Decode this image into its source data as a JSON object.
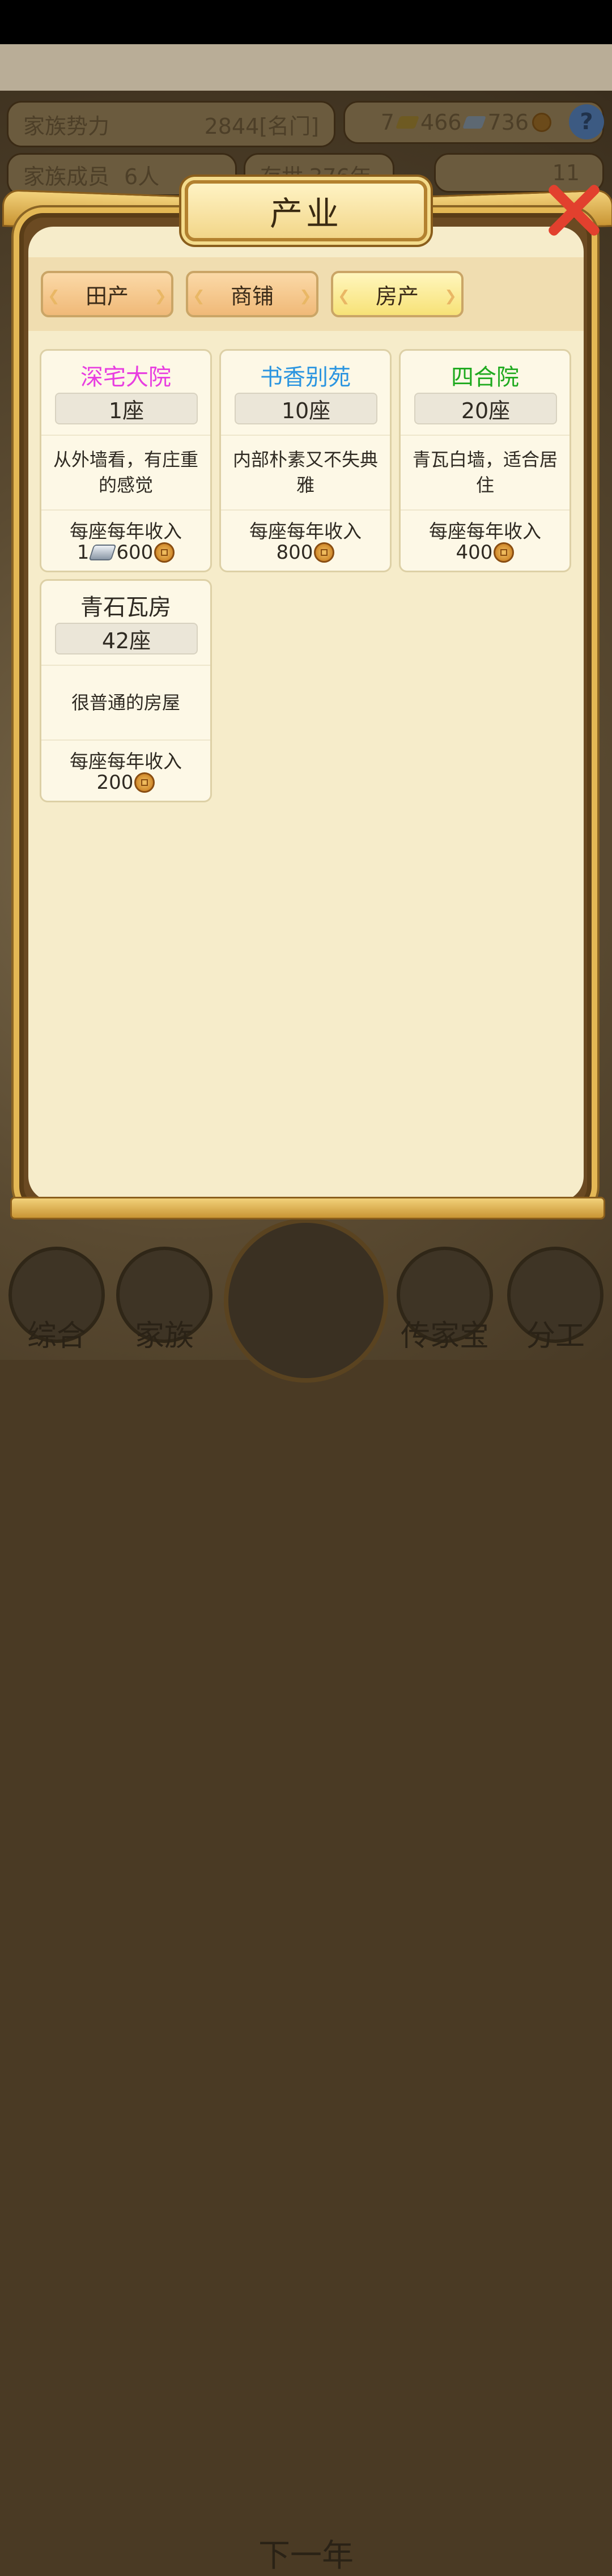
{
  "background_hud": {
    "family_power_label": "家族势力",
    "family_power_value": "2844",
    "family_power_rank": "[名门]",
    "gold_count": "7",
    "silver_count": "466",
    "coin_count": "736",
    "help_label": "?",
    "members_label": "家族成员",
    "members_value": "6人",
    "existence_label": "存世",
    "existence_value": "376年",
    "yuanbao_count": "11"
  },
  "dialog": {
    "title": "产业",
    "tabs": [
      {
        "label": "田产",
        "active": false
      },
      {
        "label": "商铺",
        "active": false
      },
      {
        "label": "房产",
        "active": true
      }
    ],
    "cards": [
      {
        "name": "深宅大院",
        "name_color": "#e83ee0",
        "count": "1座",
        "description": "从外墙看，有庄重的感觉",
        "income_label": "每座每年收入",
        "income_silver": "1",
        "income_coins": "600"
      },
      {
        "name": "书香别苑",
        "name_color": "#2b95e0",
        "count": "10座",
        "description": "内部朴素又不失典雅",
        "income_label": "每座每年收入",
        "income_coins": "800"
      },
      {
        "name": "四合院",
        "name_color": "#1faa1f",
        "count": "20座",
        "description": "青瓦白墙，适合居住",
        "income_label": "每座每年收入",
        "income_coins": "400"
      },
      {
        "name": "青石瓦房",
        "name_color": "#2f2a22",
        "count": "42座",
        "description": "很普通的房屋",
        "income_label": "每座每年收入",
        "income_coins": "200"
      }
    ]
  },
  "bottom_nav": {
    "items": [
      "综合",
      "家族",
      "下一年",
      "传家宝",
      "分工"
    ]
  },
  "icons": {
    "coin": "copper-coin-icon",
    "silver": "silver-ingot-icon",
    "close": "close-icon",
    "help": "help-icon"
  }
}
